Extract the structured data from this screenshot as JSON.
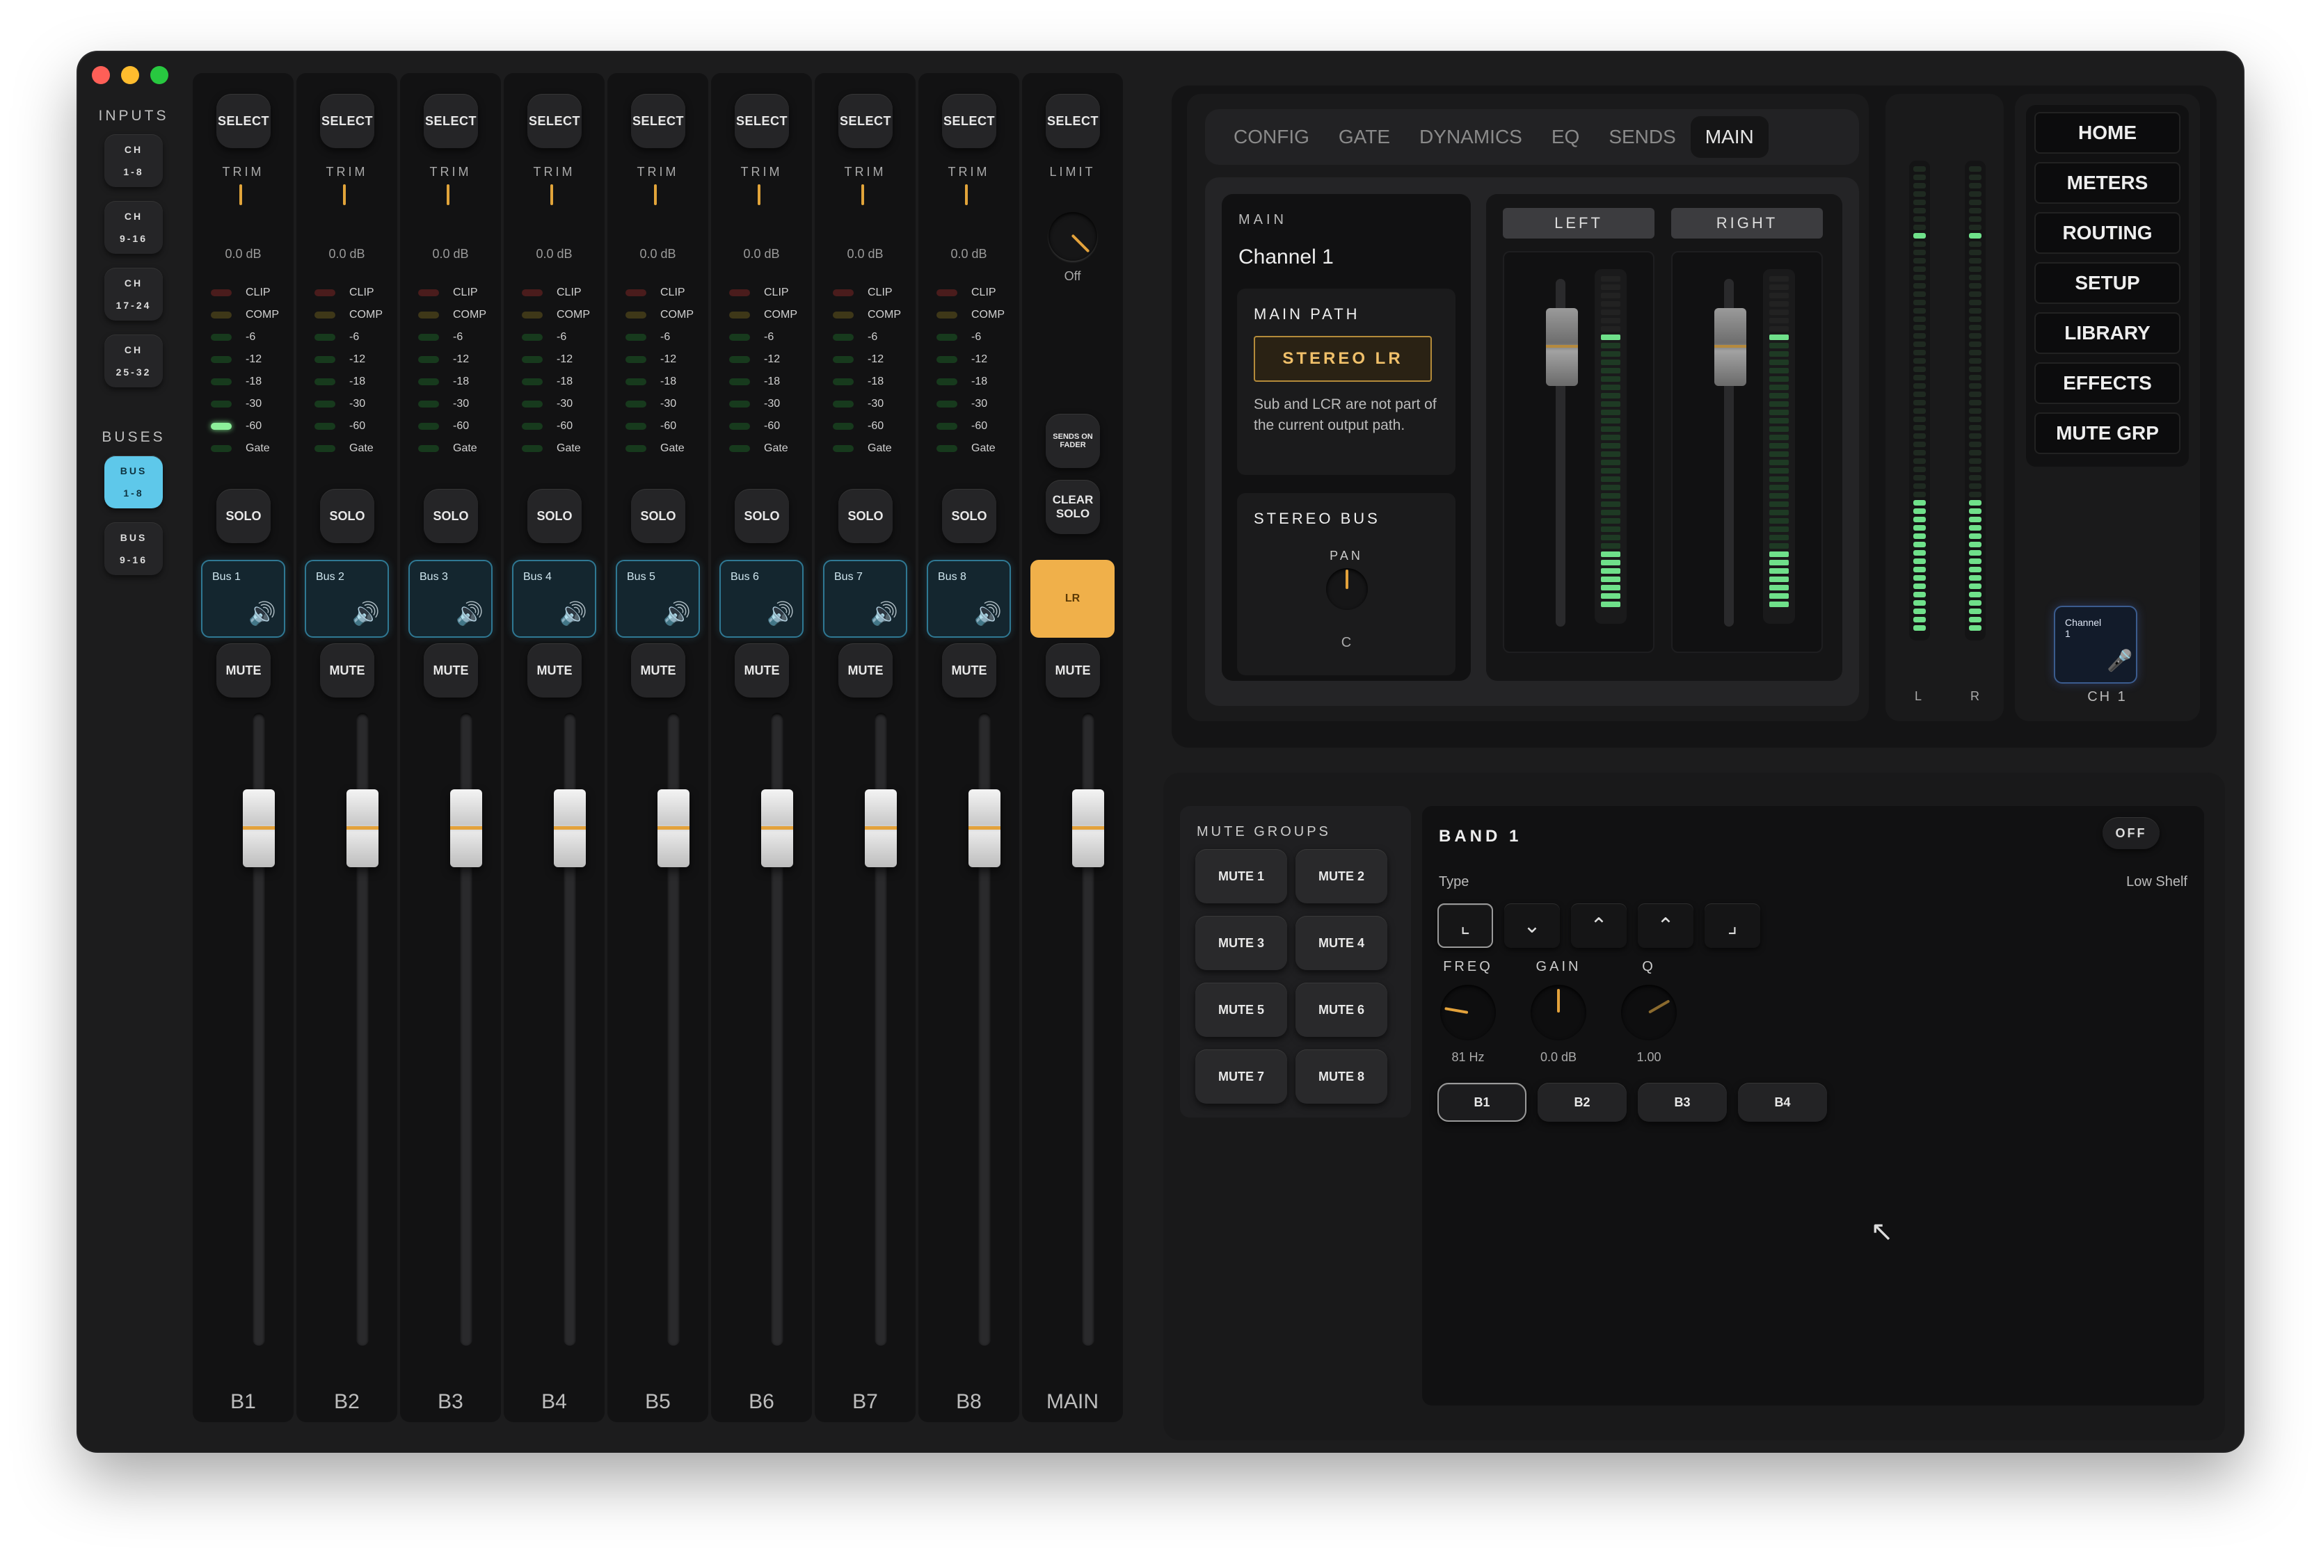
{
  "colors": {
    "accent_bus": "#5ec8ea",
    "accent_main": "#f0b04a",
    "trim": "#e1a43a",
    "meter_green": "#6fe08a"
  },
  "nav": {
    "inputs_title": "INPUTS",
    "inputs": [
      {
        "l1": "CH",
        "l2": "1-8"
      },
      {
        "l1": "CH",
        "l2": "9-16"
      },
      {
        "l1": "CH",
        "l2": "17-24"
      },
      {
        "l1": "CH",
        "l2": "25-32"
      }
    ],
    "buses_title": "BUSES",
    "buses": [
      {
        "l1": "BUS",
        "l2": "1-8",
        "active": true
      },
      {
        "l1": "BUS",
        "l2": "9-16",
        "active": false
      }
    ]
  },
  "strip_labels": {
    "select": "SELECT",
    "trim": "TRIM",
    "solo": "SOLO",
    "mute": "MUTE",
    "meter": [
      "CLIP",
      "COMP",
      "-6",
      "-12",
      "-18",
      "-30",
      "-60",
      "Gate"
    ]
  },
  "strips": [
    {
      "name": "B1",
      "trim_val": "0.0 dB",
      "bus": "Bus 1"
    },
    {
      "name": "B2",
      "trim_val": "0.0 dB",
      "bus": "Bus 2"
    },
    {
      "name": "B3",
      "trim_val": "0.0 dB",
      "bus": "Bus 3"
    },
    {
      "name": "B4",
      "trim_val": "0.0 dB",
      "bus": "Bus 4"
    },
    {
      "name": "B5",
      "trim_val": "0.0 dB",
      "bus": "Bus 5"
    },
    {
      "name": "B6",
      "trim_val": "0.0 dB",
      "bus": "Bus 6"
    },
    {
      "name": "B7",
      "trim_val": "0.0 dB",
      "bus": "Bus 7"
    },
    {
      "name": "B8",
      "trim_val": "0.0 dB",
      "bus": "Bus 8"
    }
  ],
  "main_strip": {
    "select": "SELECT",
    "limit": "LIMIT",
    "limit_val": "Off",
    "sends_on_fader": "SENDS ON FADER",
    "clear_solo_1": "CLEAR",
    "clear_solo_2": "SOLO",
    "lr": "LR",
    "mute": "MUTE",
    "name": "MAIN"
  },
  "tabs": [
    "CONFIG",
    "GATE",
    "DYNAMICS",
    "EQ",
    "SENDS",
    "MAIN"
  ],
  "active_tab": "MAIN",
  "main_panel": {
    "title": "MAIN",
    "channel": "Channel 1",
    "main_path_title": "MAIN PATH",
    "main_path_value": "STEREO LR",
    "main_path_note": "Sub and LCR are not part of the current output path.",
    "stereo_bus_title": "STEREO BUS",
    "pan_label": "PAN",
    "pan_value": "C",
    "left": "LEFT",
    "right": "RIGHT"
  },
  "master_meter": {
    "l": "L",
    "r": "R"
  },
  "right_nav": [
    "HOME",
    "METERS",
    "ROUTING",
    "SETUP",
    "LIBRARY",
    "EFFECTS",
    "MUTE GRP"
  ],
  "channel_tile": {
    "label": "Channel 1",
    "ch": "CH 1"
  },
  "mute_groups": {
    "title": "MUTE GROUPS",
    "items": [
      "MUTE 1",
      "MUTE 2",
      "MUTE 3",
      "MUTE 4",
      "MUTE 5",
      "MUTE 6",
      "MUTE 7",
      "MUTE 8"
    ]
  },
  "band": {
    "title": "BAND 1",
    "state": "OFF",
    "type_label": "Type",
    "type_value": "Low Shelf",
    "freq_label": "FREQ",
    "freq_value": "81 Hz",
    "gain_label": "GAIN",
    "gain_value": "0.0 dB",
    "q_label": "Q",
    "q_value": "1.00",
    "bands": [
      "B1",
      "B2",
      "B3",
      "B4"
    ],
    "active_band": "B1"
  }
}
